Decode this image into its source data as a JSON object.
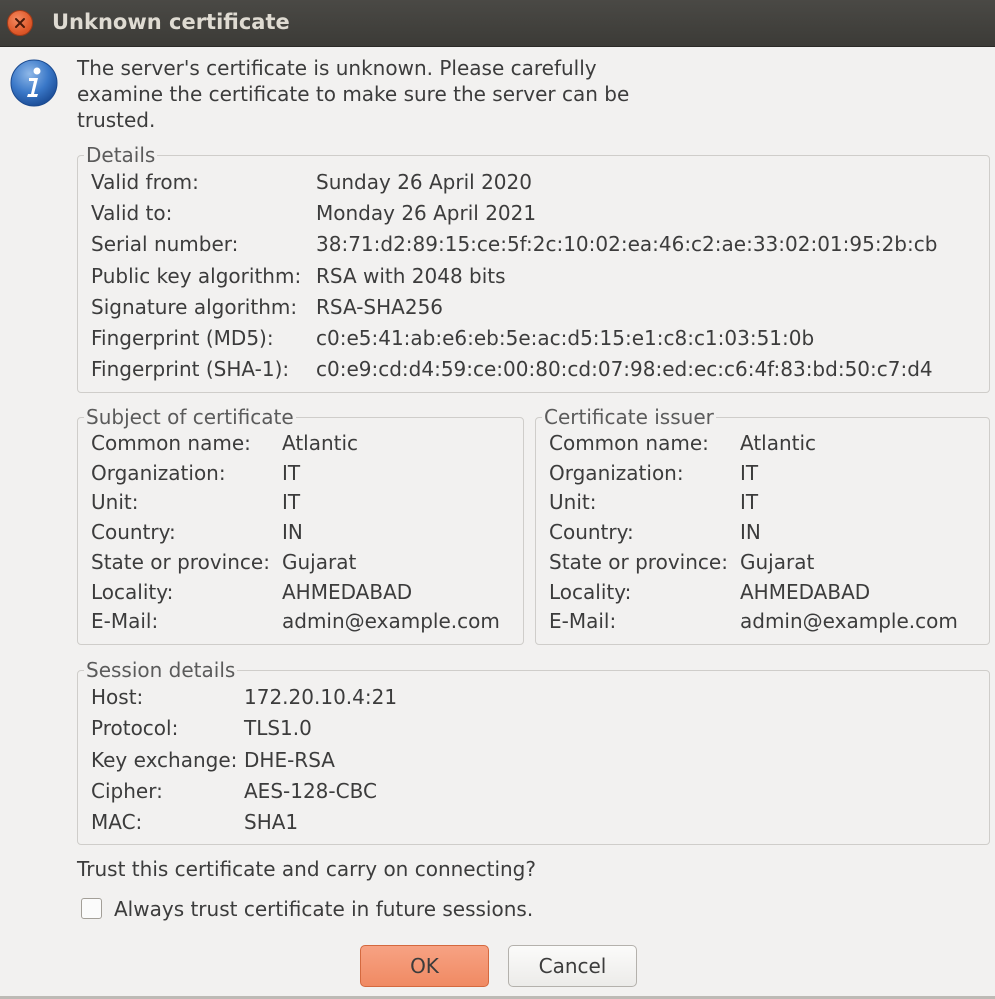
{
  "window": {
    "title": "Unknown certificate"
  },
  "intro_text": "The server's certificate is unknown. Please carefully examine the certificate to make sure the server can be trusted.",
  "details": {
    "title": "Details",
    "rows": [
      {
        "label": "Valid from:",
        "value": "Sunday 26 April 2020"
      },
      {
        "label": "Valid to:",
        "value": "Monday 26 April 2021"
      },
      {
        "label": "Serial number:",
        "value": "38:71:d2:89:15:ce:5f:2c:10:02:ea:46:c2:ae:33:02:01:95:2b:cb"
      },
      {
        "label": "Public key algorithm:",
        "value": "RSA with 2048 bits"
      },
      {
        "label": "Signature algorithm:",
        "value": "RSA-SHA256"
      },
      {
        "label": "Fingerprint (MD5):",
        "value": "c0:e5:41:ab:e6:eb:5e:ac:d5:15:e1:c8:c1:03:51:0b"
      },
      {
        "label": "Fingerprint (SHA-1):",
        "value": "c0:e9:cd:d4:59:ce:00:80:cd:07:98:ed:ec:c6:4f:83:bd:50:c7:d4"
      }
    ]
  },
  "subject": {
    "title": "Subject of certificate",
    "rows": [
      {
        "label": "Common name:",
        "value": "Atlantic"
      },
      {
        "label": "Organization:",
        "value": "IT"
      },
      {
        "label": "Unit:",
        "value": "IT"
      },
      {
        "label": "Country:",
        "value": "IN"
      },
      {
        "label": "State or province:",
        "value": "Gujarat"
      },
      {
        "label": "Locality:",
        "value": "AHMEDABAD"
      },
      {
        "label": "E-Mail:",
        "value": "admin@example.com"
      }
    ]
  },
  "issuer": {
    "title": "Certificate issuer",
    "rows": [
      {
        "label": "Common name:",
        "value": "Atlantic"
      },
      {
        "label": "Organization:",
        "value": "IT"
      },
      {
        "label": "Unit:",
        "value": "IT"
      },
      {
        "label": "Country:",
        "value": "IN"
      },
      {
        "label": "State or province:",
        "value": "Gujarat"
      },
      {
        "label": "Locality:",
        "value": "AHMEDABAD"
      },
      {
        "label": "E-Mail:",
        "value": "admin@example.com"
      }
    ]
  },
  "session": {
    "title": "Session details",
    "rows": [
      {
        "label": "Host:",
        "value": "172.20.10.4:21"
      },
      {
        "label": "Protocol:",
        "value": "TLS1.0"
      },
      {
        "label": "Key exchange:",
        "value": "DHE-RSA"
      },
      {
        "label": "Cipher:",
        "value": "AES-128-CBC"
      },
      {
        "label": "MAC:",
        "value": "SHA1"
      }
    ]
  },
  "question": "Trust this certificate and carry on connecting?",
  "always_trust": {
    "label": "Always trust certificate in future sessions.",
    "checked": false
  },
  "buttons": {
    "ok": "OK",
    "cancel": "Cancel"
  },
  "icons": {
    "close": "close-icon",
    "info": "info-icon",
    "checkbox": "checkbox-unchecked"
  },
  "colors": {
    "accent": "#f08a63",
    "titlebar": "#3c3b37",
    "background": "#f2f1f0"
  }
}
